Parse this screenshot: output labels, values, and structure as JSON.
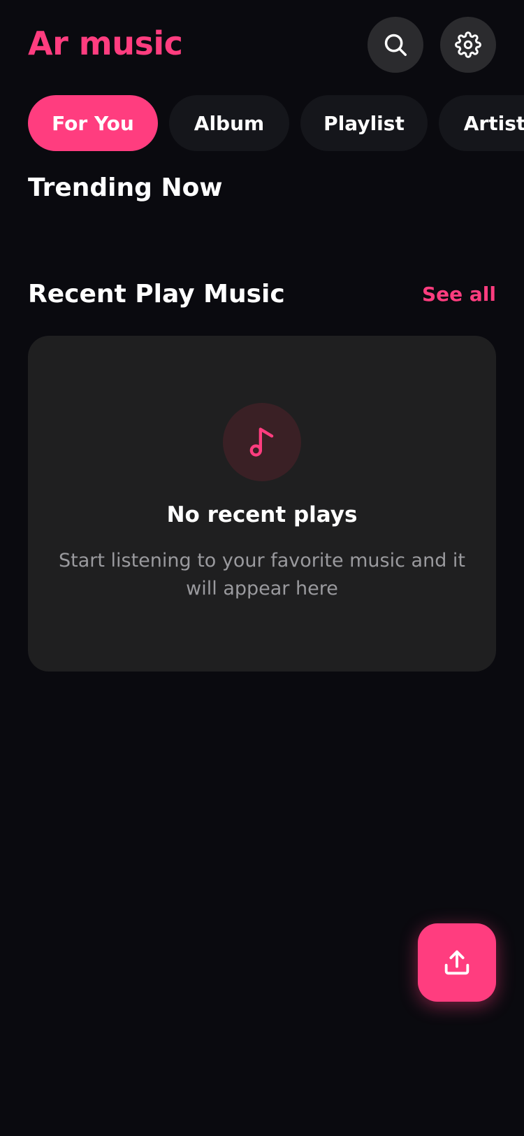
{
  "header": {
    "title": "Ar music",
    "search_icon": "search-icon",
    "settings_icon": "gear-icon"
  },
  "tabs": [
    {
      "label": "For You",
      "active": true
    },
    {
      "label": "Album",
      "active": false
    },
    {
      "label": "Playlist",
      "active": false
    },
    {
      "label": "Artist",
      "active": false
    }
  ],
  "trending": {
    "title": "Trending Now"
  },
  "recent": {
    "title": "Recent Play Music",
    "see_all_label": "See all",
    "empty": {
      "icon": "music-note-icon",
      "title": "No recent plays",
      "message": "Start listening to your favorite music and it will appear here"
    }
  },
  "fab": {
    "icon": "upload-icon"
  },
  "colors": {
    "accent": "#ff3d7f",
    "background": "#0a0a0f",
    "card": "#1f1f20",
    "chip": "#15161b",
    "icon_button": "#2b2b2e",
    "muted_text": "#9a9a9e"
  }
}
